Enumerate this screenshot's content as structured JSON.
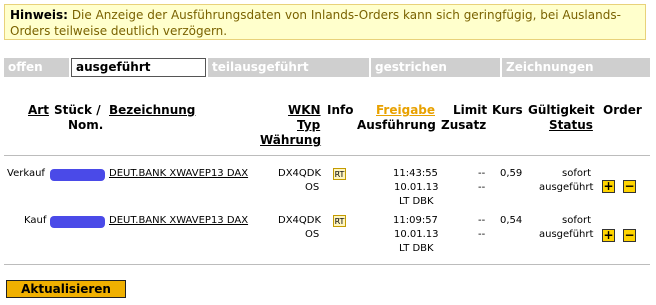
{
  "hint": {
    "label": "Hinweis:",
    "text": "Die Anzeige der Ausführungsdaten von Inlands-Orders kann sich geringfügig, bei Auslands-Orders teilweise deutlich verzögern."
  },
  "tabs": [
    "offen",
    "ausgeführt",
    "teilausgeführt",
    "gestrichen",
    "Zeichnungen"
  ],
  "headers": {
    "art": "Art",
    "stueck": "Stück /",
    "nom": "Nom.",
    "bezeichnung": "Bezeichnung",
    "wkn": "WKN",
    "typ": "Typ",
    "waehrung": "Währung",
    "info": "Info",
    "freigabe": "Freigabe",
    "ausfuehrung": "Ausführung",
    "limit": "Limit",
    "zusatz": "Zusatz",
    "kurs": "Kurs",
    "gueltigkeit": "Gültigkeit",
    "status": "Status",
    "order": "Order"
  },
  "rows": [
    {
      "art": "Verkauf",
      "bezeichnung": "DEUT.BANK XWAVEP13 DAX",
      "wkn": "DX4QDK",
      "typ": "OS",
      "info": "RT",
      "time": "11:43:55",
      "date": "10.01.13",
      "place": "LT DBK",
      "limit": "--",
      "zusatz": "--",
      "kurs": "0,59",
      "gueltigkeit": "sofort",
      "status": "ausgeführt"
    },
    {
      "art": "Kauf",
      "bezeichnung": "DEUT.BANK XWAVEP13 DAX",
      "wkn": "DX4QDK",
      "typ": "OS",
      "info": "RT",
      "time": "11:09:57",
      "date": "10.01.13",
      "place": "LT DBK",
      "limit": "--",
      "zusatz": "--",
      "kurs": "0,54",
      "gueltigkeit": "sofort",
      "status": "ausgeführt"
    }
  ],
  "order_buttons": {
    "plus": "+",
    "minus": "−"
  },
  "refresh_label": "Aktualisieren",
  "colors": {
    "accent": "#f0b000",
    "hint_bg": "#ffffcc",
    "tab_inactive": "#cfcfcf",
    "redaction": "#4a4ae8"
  }
}
